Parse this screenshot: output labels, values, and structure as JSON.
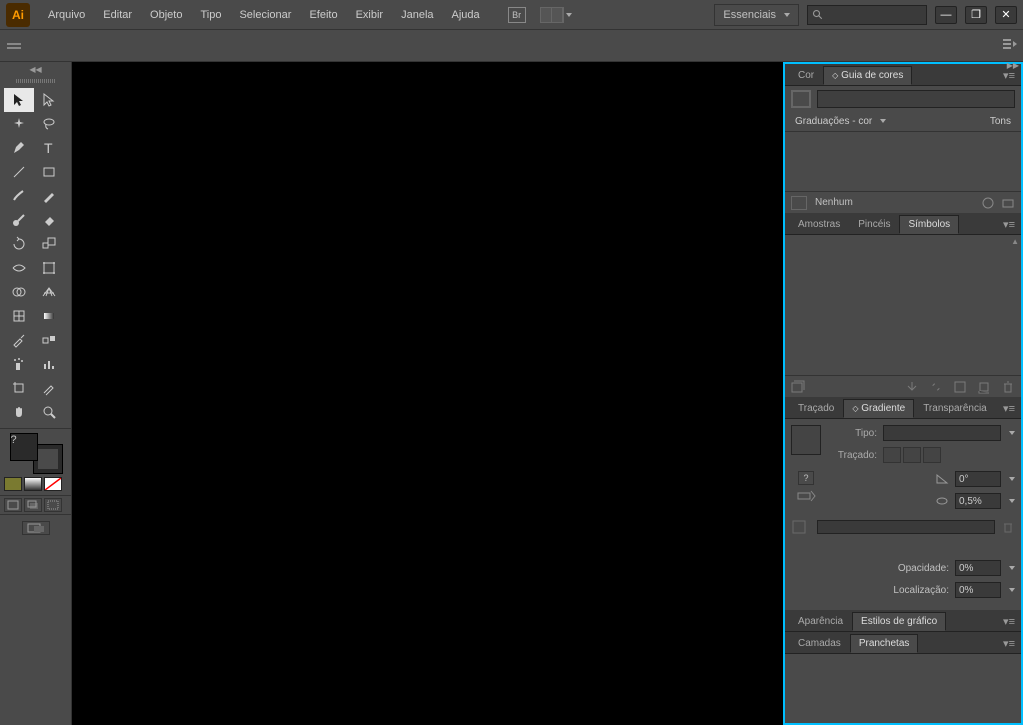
{
  "app": {
    "logo": "Ai"
  },
  "menu": {
    "arquivo": "Arquivo",
    "editar": "Editar",
    "objeto": "Objeto",
    "tipo": "Tipo",
    "selecionar": "Selecionar",
    "efeito": "Efeito",
    "exibir": "Exibir",
    "janela": "Janela",
    "ajuda": "Ajuda",
    "br": "Br",
    "workspace": "Essenciais"
  },
  "panels": {
    "cor_tab": "Cor",
    "guia_tab": "Guia de cores",
    "graduacoes": "Graduações - cor",
    "tons": "Tons",
    "nenhum": "Nenhum",
    "amostras_tab": "Amostras",
    "pinceis_tab": "Pincéis",
    "simbolos_tab": "Símbolos",
    "tracado_tab": "Traçado",
    "gradiente_tab": "Gradiente",
    "transparencia_tab": "Transparência",
    "tipo_label": "Tipo:",
    "tracado_label": "Traçado:",
    "angle_value": "0°",
    "ratio_value": "0,5%",
    "opacidade_label": "Opacidade:",
    "opacidade_value": "0%",
    "localizacao_label": "Localização:",
    "localizacao_value": "0%",
    "aparencia_tab": "Aparência",
    "estilos_tab": "Estilos de gráfico",
    "camadas_tab": "Camadas",
    "pranchetas_tab": "Pranchetas"
  }
}
